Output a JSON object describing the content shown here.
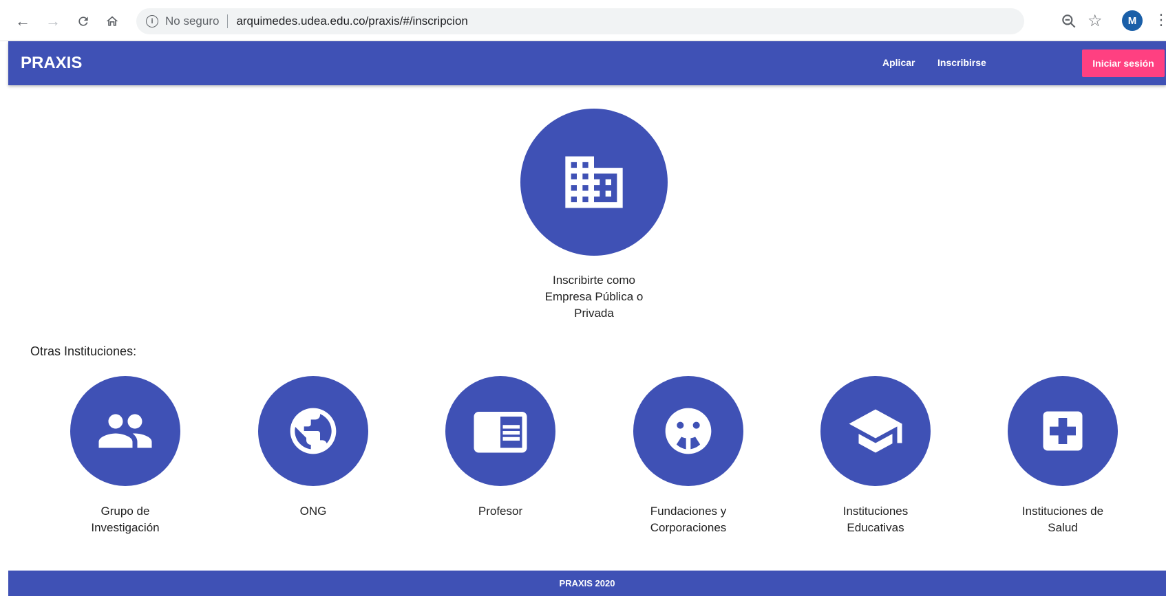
{
  "browser": {
    "security_label": "No seguro",
    "url": "arquimedes.udea.edu.co/praxis/#/inscripcion",
    "avatar_letter": "M",
    "icons": [
      "back-arrow-icon",
      "forward-arrow-icon",
      "reload-icon",
      "home-icon",
      "info-icon",
      "zoom-icon",
      "star-icon",
      "more-vert-icon"
    ]
  },
  "appbar": {
    "brand": "PRAXIS",
    "nav": {
      "apply": "Aplicar",
      "register": "Inscribirse",
      "login": "Iniciar sesión"
    },
    "colors": {
      "primary": "#3f51b5",
      "accent": "#ff4081"
    }
  },
  "main": {
    "primary_option": {
      "icon": "domain-icon",
      "label_lines": [
        "Inscribirte como",
        "Empresa Pública o",
        "Privada"
      ]
    },
    "section_title": "Otras Instituciones:",
    "options": [
      {
        "icon": "people-icon",
        "label_lines": [
          "Grupo de",
          "Investigación"
        ]
      },
      {
        "icon": "public-globe-icon",
        "label_lines": [
          "ONG"
        ]
      },
      {
        "icon": "chrome-reader-book-icon",
        "label_lines": [
          "Profesor"
        ]
      },
      {
        "icon": "child-care-icon",
        "label_lines": [
          "Fundaciones y",
          "Corporaciones"
        ]
      },
      {
        "icon": "school-icon",
        "label_lines": [
          "Instituciones",
          "Educativas"
        ]
      },
      {
        "icon": "local-hospital-icon",
        "label_lines": [
          "Instituciones de",
          "Salud"
        ]
      }
    ]
  },
  "footer": {
    "text": "PRAXIS 2020"
  }
}
